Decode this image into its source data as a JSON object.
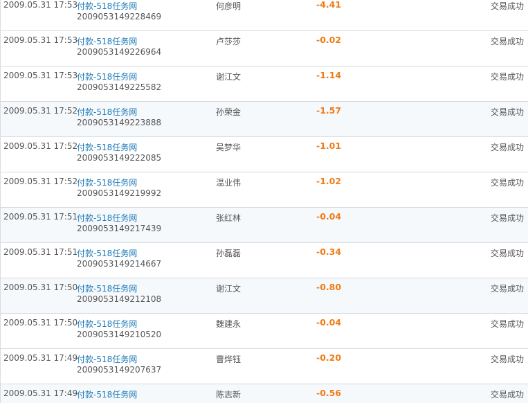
{
  "transactions": [
    {
      "time": "2009.05.31 17:53",
      "title": "付款-518任务网",
      "order_no": "2009053149228469",
      "name": "何彦明",
      "amount": "-4.41",
      "status": "交易成功"
    },
    {
      "time": "2009.05.31 17:53",
      "title": "付款-518任务网",
      "order_no": "2009053149226964",
      "name": "卢莎莎",
      "amount": "-0.02",
      "status": "交易成功"
    },
    {
      "time": "2009.05.31 17:53",
      "title": "付款-518任务网",
      "order_no": "2009053149225582",
      "name": "谢江文",
      "amount": "-1.14",
      "status": "交易成功"
    },
    {
      "time": "2009.05.31 17:52",
      "title": "付款-518任务网",
      "order_no": "2009053149223888",
      "name": "孙荣金",
      "amount": "-1.57",
      "status": "交易成功"
    },
    {
      "time": "2009.05.31 17:52",
      "title": "付款-518任务网",
      "order_no": "2009053149222085",
      "name": "吴梦华",
      "amount": "-1.01",
      "status": "交易成功"
    },
    {
      "time": "2009.05.31 17:52",
      "title": "付款-518任务网",
      "order_no": "2009053149219992",
      "name": "温业伟",
      "amount": "-1.02",
      "status": "交易成功"
    },
    {
      "time": "2009.05.31 17:51",
      "title": "付款-518任务网",
      "order_no": "2009053149217439",
      "name": "张红林",
      "amount": "-0.04",
      "status": "交易成功"
    },
    {
      "time": "2009.05.31 17:51",
      "title": "付款-518任务网",
      "order_no": "2009053149214667",
      "name": "孙磊磊",
      "amount": "-0.34",
      "status": "交易成功"
    },
    {
      "time": "2009.05.31 17:50",
      "title": "付款-518任务网",
      "order_no": "2009053149212108",
      "name": "谢江文",
      "amount": "-0.80",
      "status": "交易成功"
    },
    {
      "time": "2009.05.31 17:50",
      "title": "付款-518任务网",
      "order_no": "2009053149210520",
      "name": "魏建永",
      "amount": "-0.04",
      "status": "交易成功"
    },
    {
      "time": "2009.05.31 17:49",
      "title": "付款-518任务网",
      "order_no": "2009053149207637",
      "name": "曹烨钰",
      "amount": "-0.20",
      "status": "交易成功"
    },
    {
      "time": "2009.05.31 17:49",
      "title": "付款-518任务网",
      "order_no": "",
      "name": "陈志新",
      "amount": "-0.56",
      "status": "交易成功"
    }
  ],
  "colors": {
    "title_link": "#1d7ab8",
    "amount": "#f07b16",
    "row_divider": "#d5d9de",
    "row_alt_bg": "#f6f9fc"
  }
}
